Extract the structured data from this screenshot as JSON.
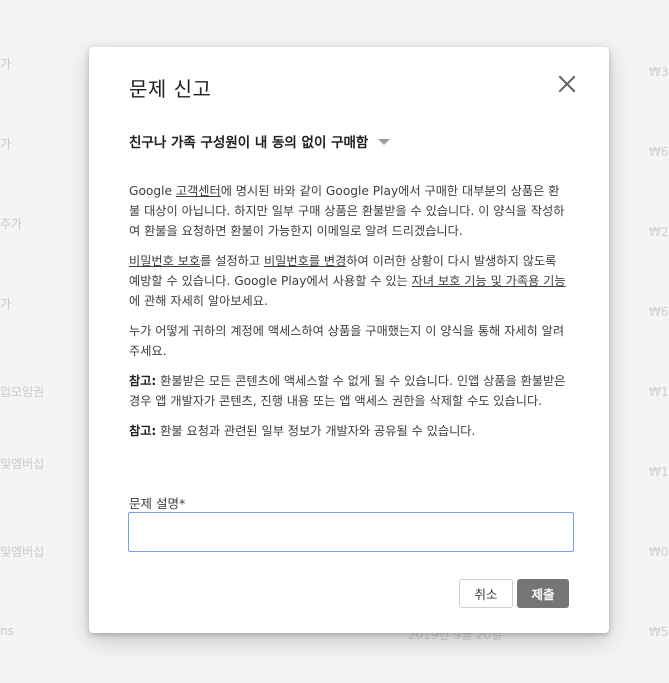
{
  "background": {
    "left_fragments": [
      "가",
      "가",
      "추가",
      "가",
      "업모임권",
      "및엠버십",
      "및엠버십",
      "ns"
    ],
    "right_fragments": [
      "₩3,",
      "₩6,",
      "₩28",
      "₩6,",
      "₩14",
      "₩1,",
      "₩0",
      "₩5,"
    ],
    "date_fragment": "2019년 9월 20일"
  },
  "dialog": {
    "title": "문제 신고",
    "reason_selected": "친구나 가족 구성원이 내 동의 없이 구매함",
    "paragraph1": {
      "t1": "Google ",
      "link1": "고객센터",
      "t2": "에 명시된 바와 같이 Google Play에서 구매한 대부분의 상품은 환불 대상이 아닙니다. 하지만 일부 구매 상품은 환불받을 수 있습니다. 이 양식을 작성하여 환불을 요청하면 환불이 가능한지 이메일로 알려 드리겠습니다."
    },
    "paragraph2": {
      "link1": "비밀번호 보호",
      "t1": "를 설정하고 ",
      "link2": "비밀번호를 변경",
      "t2": "하여 이러한 상황이 다시 발생하지 않도록 예방할 수 있습니다. Google Play에서 사용할 수 있는 ",
      "link3": "자녀 보호 기능 및 가족용 기능",
      "t3": "에 관해 자세히 알아보세요."
    },
    "paragraph3": "누가 어떻게 귀하의 계정에 액세스하여 상품을 구매했는지 이 양식을 통해 자세히 알려 주세요.",
    "note1": {
      "label": "참고:",
      "text": " 환불받은 모든 콘텐츠에 액세스할 수 없게 될 수 있습니다. 인앱 상품을 환불받은 경우 앱 개발자가 콘텐츠, 진행 내용 또는 앱 액세스 권한을 삭제할 수도 있습니다."
    },
    "note2": {
      "label": "참고:",
      "text": " 환불 요청과 관련된 일부 정보가 개발자와 공유될 수 있습니다."
    },
    "field_label": "문제 설명*",
    "field_value": "",
    "cancel_label": "취소",
    "submit_label": "제출"
  }
}
